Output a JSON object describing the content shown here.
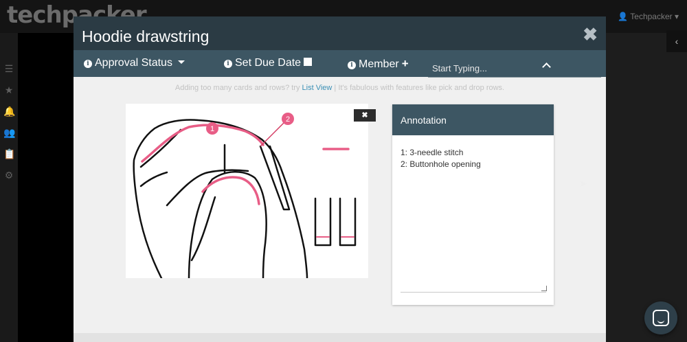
{
  "app": {
    "logo": "techpacker",
    "user_name": "Techpacker"
  },
  "modal": {
    "title": "Hoodie drawstring",
    "close_glyph": "✖"
  },
  "toolbar": {
    "approval_status": "Approval Status",
    "set_due_date": "Set Due Date",
    "member": "Member",
    "search_placeholder": "Start Typing..."
  },
  "hint": {
    "prefix": "Adding too many cards and rows? try ",
    "link_text": "List View",
    "suffix": " | It's fabulous with features like pick and drop rows."
  },
  "sketch": {
    "close_glyph": "✖",
    "markers": [
      "1",
      "2"
    ]
  },
  "annotation": {
    "heading": "Annotation",
    "text": "1: 3-needle stitch\n2: Buttonhole opening"
  },
  "colors": {
    "header": "#2b3b44",
    "toolbar": "#3d5663",
    "accent_pink": "#e85d86",
    "link": "#3a8fb5"
  },
  "icons": [
    "info-icon",
    "caret-down-icon",
    "calendar-icon",
    "plus-icon",
    "chevron-up-icon",
    "close-icon",
    "chat-icon",
    "user-icon",
    "list-icon",
    "star-icon",
    "bell-icon",
    "users-icon",
    "clipboard-icon",
    "gear-icon",
    "chevron-left-icon"
  ]
}
